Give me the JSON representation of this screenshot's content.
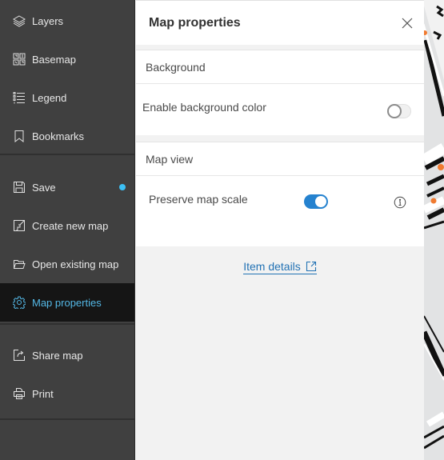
{
  "sidebar": {
    "groups": [
      [
        {
          "label": "Layers",
          "icon": "layers-icon"
        },
        {
          "label": "Basemap",
          "icon": "basemap-icon"
        },
        {
          "label": "Legend",
          "icon": "legend-icon"
        },
        {
          "label": "Bookmarks",
          "icon": "bookmark-icon"
        }
      ],
      [
        {
          "label": "Save",
          "icon": "save-icon",
          "badge": "unsaved-changes-dot"
        },
        {
          "label": "Create new map",
          "icon": "new-map-icon"
        },
        {
          "label": "Open existing map",
          "icon": "folder-open-icon"
        },
        {
          "label": "Map properties",
          "icon": "gear-icon",
          "active": true
        }
      ],
      [
        {
          "label": "Share map",
          "icon": "share-icon"
        },
        {
          "label": "Print",
          "icon": "print-icon"
        }
      ]
    ],
    "colors": {
      "background": "#404040",
      "active_bg": "#151515",
      "active_text": "#54b8e6",
      "badge": "#3cc0f5"
    }
  },
  "panel": {
    "title": "Map properties",
    "close_label": "Close",
    "sections": [
      {
        "heading": "Background",
        "settings": [
          {
            "label": "Enable background color",
            "enabled": false
          }
        ]
      },
      {
        "heading": "Map view",
        "settings": [
          {
            "label": "Preserve map scale",
            "enabled": true,
            "has_info": true
          }
        ]
      }
    ],
    "link": {
      "label": "Item details",
      "icon": "external-link-icon"
    },
    "colors": {
      "toggle_on": "#2582cf",
      "link": "#2272b4"
    }
  }
}
